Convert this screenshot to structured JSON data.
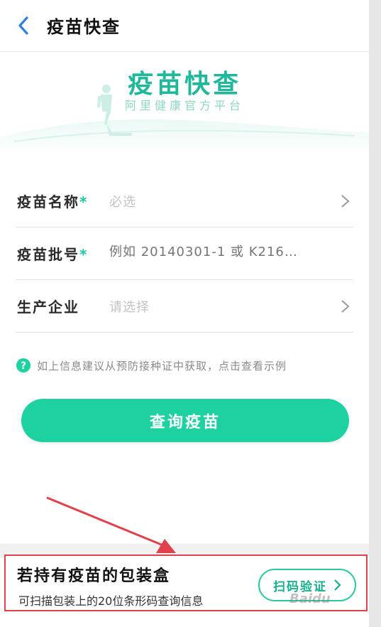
{
  "header": {
    "back_icon": "chevron-left-icon",
    "title": "疫苗快查"
  },
  "banner": {
    "title": "疫苗快查",
    "subtitle": "阿里健康官方平台"
  },
  "form": {
    "rows": [
      {
        "label": "疫苗名称",
        "required": "*",
        "value": "必选",
        "chevron": true
      },
      {
        "label": "疫苗批号",
        "required": "*",
        "placeholder": "例如 20140301-1 或 K216…",
        "chevron": false
      },
      {
        "label": "生产企业",
        "required": "",
        "value": "请选择",
        "chevron": true
      }
    ]
  },
  "hint": {
    "icon": "question-circle-icon",
    "text": "如上信息建议从预防接种证中获取，点击查看示例"
  },
  "query_button": {
    "label": "查询疫苗"
  },
  "promo": {
    "title": "若持有疫苗的包装盒",
    "description": "可扫描包装上的20位条形码查询信息",
    "scan_button": "扫码验证"
  },
  "colors": {
    "accent": "#1dd1a1",
    "title_green": "#1fb89a",
    "back_arrow": "#2f7fe0",
    "annotation_red": "#e0414b"
  }
}
